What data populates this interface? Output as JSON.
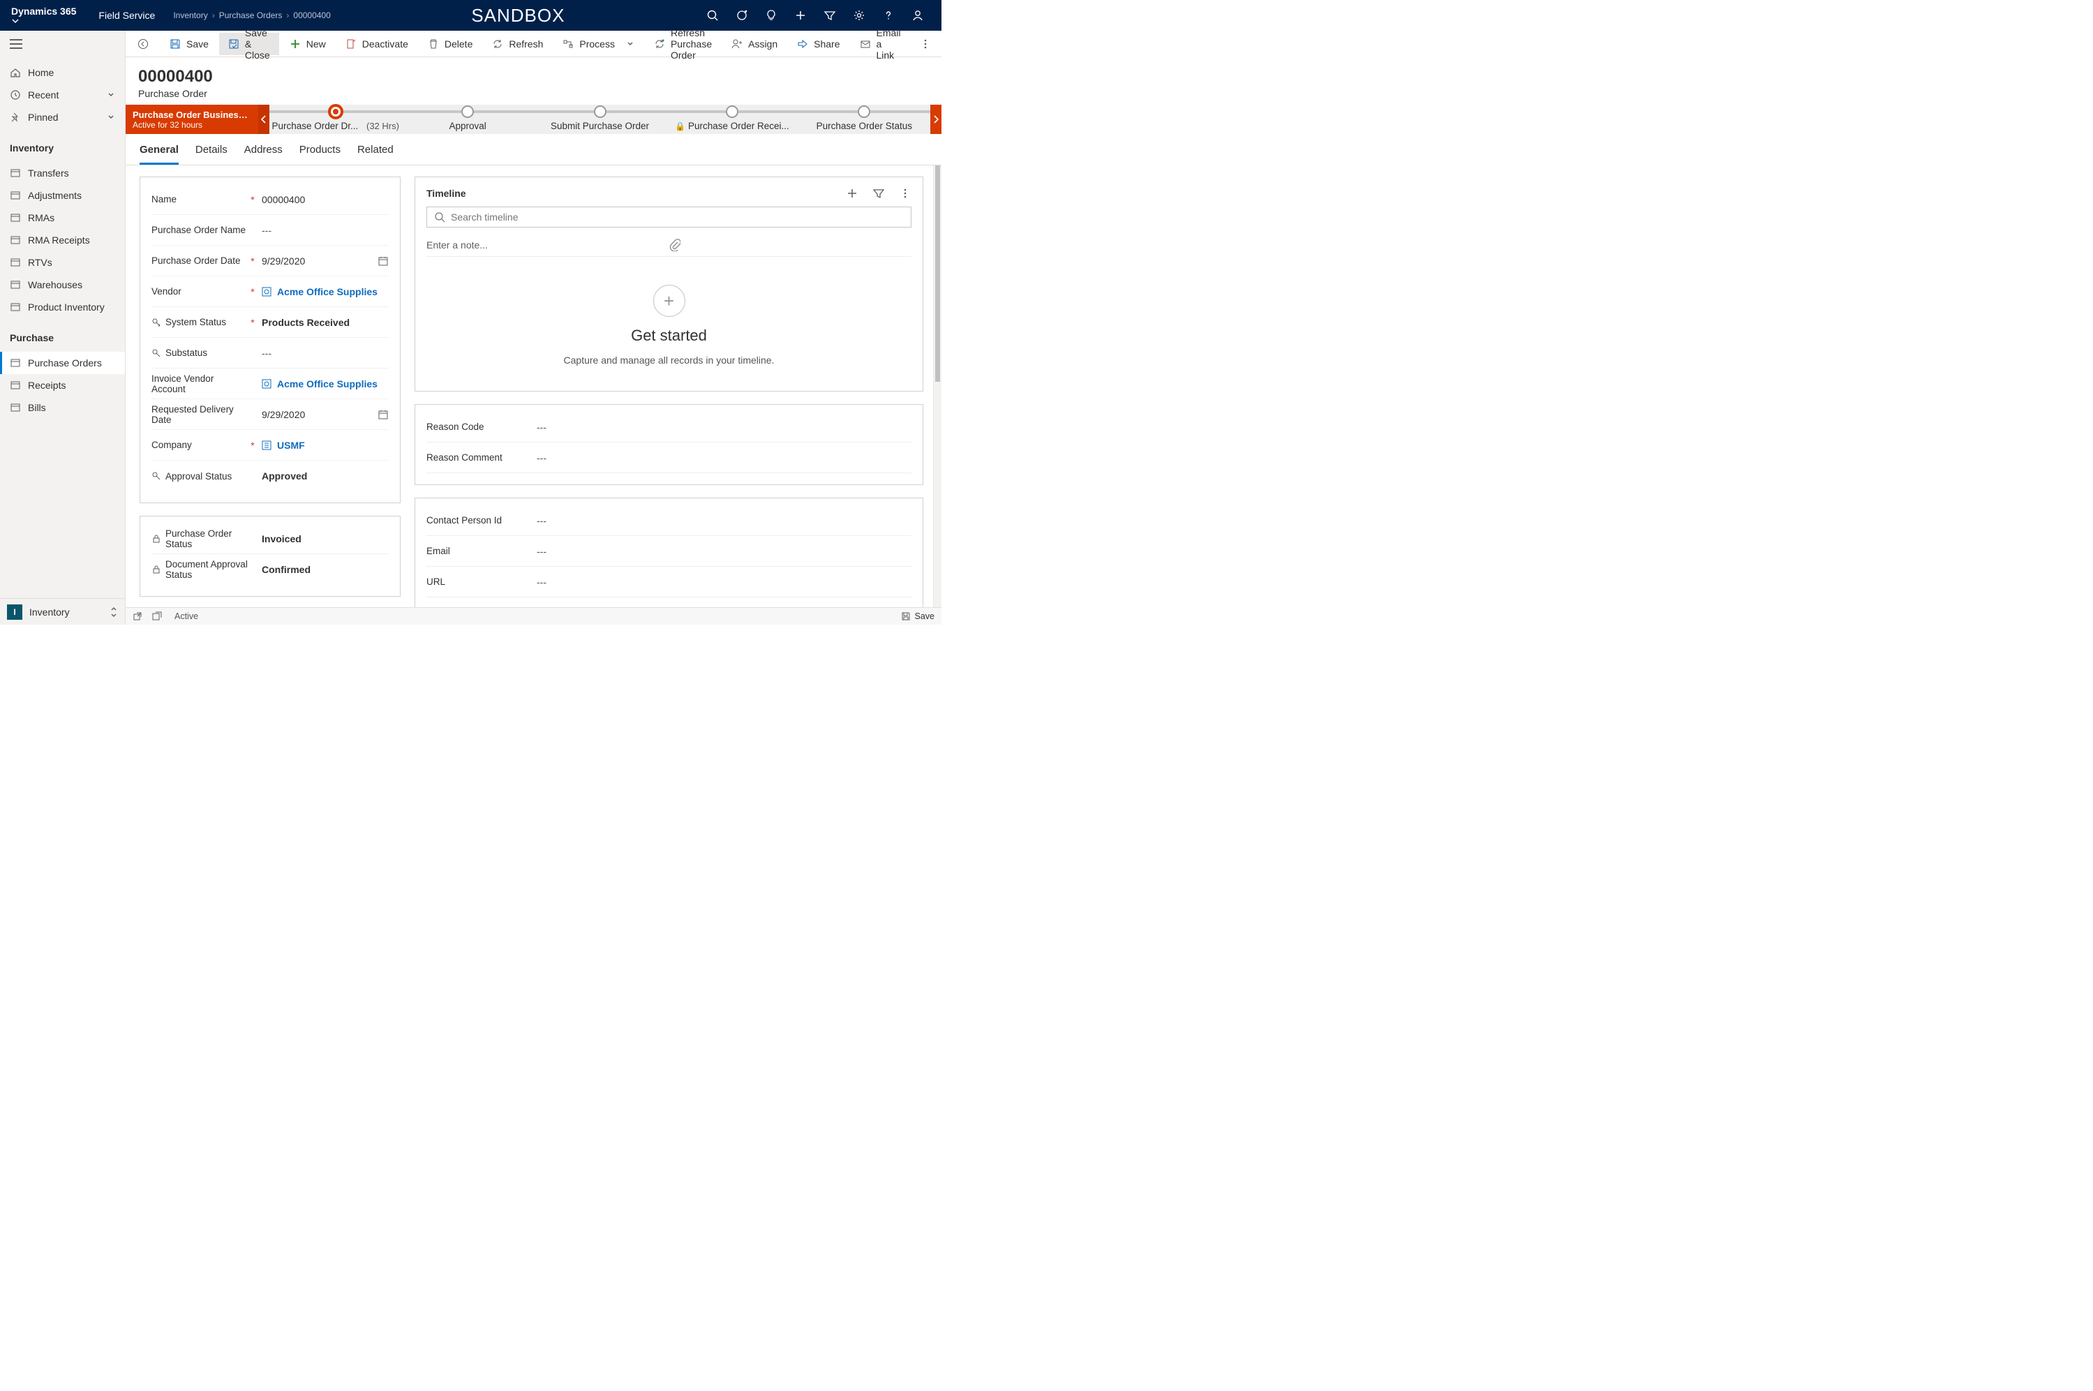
{
  "topnav": {
    "brand": "Dynamics 365",
    "module": "Field Service",
    "breadcrumb": [
      "Inventory",
      "Purchase Orders",
      "00000400"
    ],
    "env": "SANDBOX"
  },
  "sidebar": {
    "nav_top": [
      {
        "icon": "home",
        "label": "Home"
      },
      {
        "icon": "clock",
        "label": "Recent",
        "expandable": true
      },
      {
        "icon": "pin",
        "label": "Pinned",
        "expandable": true
      }
    ],
    "group_inventory": {
      "header": "Inventory",
      "items": [
        {
          "label": "Transfers"
        },
        {
          "label": "Adjustments"
        },
        {
          "label": "RMAs"
        },
        {
          "label": "RMA Receipts"
        },
        {
          "label": "RTVs"
        },
        {
          "label": "Warehouses"
        },
        {
          "label": "Product Inventory"
        }
      ]
    },
    "group_purchase": {
      "header": "Purchase",
      "items": [
        {
          "label": "Purchase Orders",
          "selected": true
        },
        {
          "label": "Receipts"
        },
        {
          "label": "Bills"
        }
      ]
    },
    "footer": {
      "badge": "I",
      "label": "Inventory"
    }
  },
  "cmdbar": {
    "items": [
      {
        "key": "back",
        "label": "",
        "icon": "back"
      },
      {
        "key": "save",
        "label": "Save",
        "icon": "save"
      },
      {
        "key": "saveclose",
        "label": "Save & Close",
        "icon": "saveclose",
        "highlighted": true
      },
      {
        "key": "new",
        "label": "New",
        "icon": "new"
      },
      {
        "key": "deactivate",
        "label": "Deactivate",
        "icon": "deactivate"
      },
      {
        "key": "delete",
        "label": "Delete",
        "icon": "delete"
      },
      {
        "key": "refresh",
        "label": "Refresh",
        "icon": "refresh"
      },
      {
        "key": "process",
        "label": "Process",
        "icon": "process",
        "dropdown": true
      },
      {
        "key": "refreshpo",
        "label": "Refresh Purchase Order",
        "icon": "refreshpo"
      },
      {
        "key": "assign",
        "label": "Assign",
        "icon": "assign"
      },
      {
        "key": "share",
        "label": "Share",
        "icon": "share"
      },
      {
        "key": "email",
        "label": "Email a Link",
        "icon": "email"
      }
    ]
  },
  "header": {
    "title": "00000400",
    "subtitle": "Purchase Order"
  },
  "process": {
    "flag_title": "Purchase Order Business ...",
    "flag_sub": "Active for 32 hours",
    "stages": [
      {
        "label": "Purchase Order Dr...",
        "sub": "(32 Hrs)",
        "active": true
      },
      {
        "label": "Approval"
      },
      {
        "label": "Submit Purchase Order"
      },
      {
        "label": "Purchase Order Recei...",
        "locked": true
      },
      {
        "label": "Purchase Order Status"
      }
    ]
  },
  "tabs": [
    "General",
    "Details",
    "Address",
    "Products",
    "Related"
  ],
  "form": {
    "name": {
      "label": "Name",
      "required": true,
      "value": "00000400"
    },
    "po_name": {
      "label": "Purchase Order Name",
      "value": "---"
    },
    "po_date": {
      "label": "Purchase Order Date",
      "required": true,
      "value": "9/29/2020"
    },
    "vendor": {
      "label": "Vendor",
      "required": true,
      "value": "Acme Office Supplies",
      "link": true
    },
    "sys_status": {
      "label": "System Status",
      "required": true,
      "value": "Products Received",
      "icon": "key"
    },
    "substatus": {
      "label": "Substatus",
      "value": "---",
      "icon": "key"
    },
    "inv_vendor": {
      "label": "Invoice Vendor Account",
      "value": "Acme Office Supplies",
      "link": true
    },
    "req_date": {
      "label": "Requested Delivery Date",
      "value": "9/29/2020"
    },
    "company": {
      "label": "Company",
      "required": true,
      "value": "USMF",
      "link": true
    },
    "approval": {
      "label": "Approval Status",
      "value": "Approved",
      "icon": "key"
    }
  },
  "form2": {
    "po_status": {
      "label": "Purchase Order Status",
      "value": "Invoiced",
      "icon": "lock"
    },
    "doc_approval": {
      "label": "Document Approval Status",
      "value": "Confirmed",
      "icon": "lock"
    }
  },
  "timeline": {
    "title": "Timeline",
    "search_placeholder": "Search timeline",
    "note_placeholder": "Enter a note...",
    "empty_heading": "Get started",
    "empty_body": "Capture and manage all records in your timeline."
  },
  "card_reason": {
    "reason_code": {
      "label": "Reason Code",
      "value": "---"
    },
    "reason_comment": {
      "label": "Reason Comment",
      "value": "---"
    }
  },
  "card_contact": {
    "contact": {
      "label": "Contact Person Id",
      "value": "---"
    },
    "email": {
      "label": "Email",
      "value": "---"
    },
    "url": {
      "label": "URL",
      "value": "---"
    }
  },
  "footer": {
    "status": "Active",
    "save": "Save"
  }
}
